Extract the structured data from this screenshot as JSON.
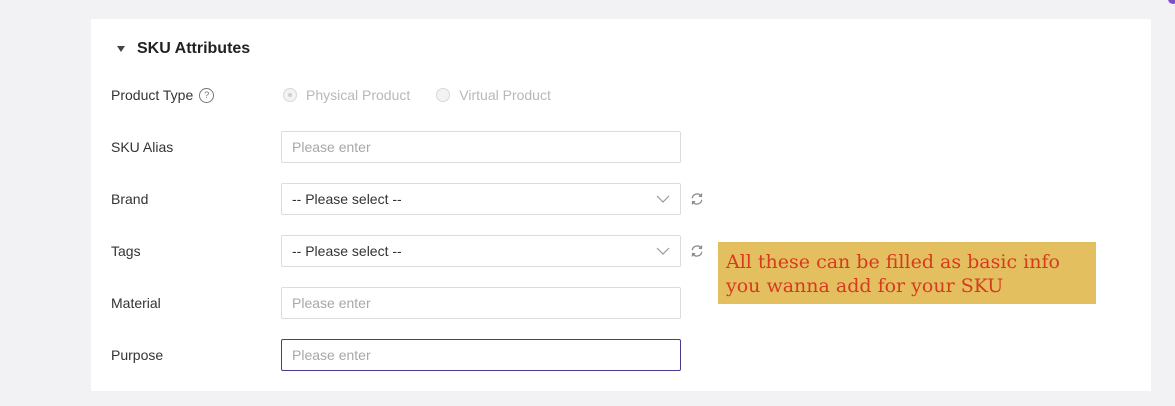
{
  "section": {
    "title": "SKU Attributes"
  },
  "product_type": {
    "label": "Product Type",
    "options": [
      "Physical Product",
      "Virtual Product"
    ],
    "selected": "Physical Product"
  },
  "sku_alias": {
    "label": "SKU Alias",
    "placeholder": "Please enter"
  },
  "brand": {
    "label": "Brand",
    "value": "-- Please select --"
  },
  "tags": {
    "label": "Tags",
    "value": "-- Please select --"
  },
  "material": {
    "label": "Material",
    "placeholder": "Please enter"
  },
  "purpose": {
    "label": "Purpose",
    "placeholder": "Please enter"
  },
  "annotation": {
    "line1": "All these can be filled as basic info",
    "line2": "you wanna add for your SKU"
  },
  "colors": {
    "focus_border": "#4b3a8f",
    "annotation_bg": "#e3bf60",
    "annotation_text": "#d83a1e"
  },
  "icons": {
    "help": "question-circle-icon",
    "refresh": "refresh-icon",
    "dropdown": "chevron-down-icon"
  }
}
